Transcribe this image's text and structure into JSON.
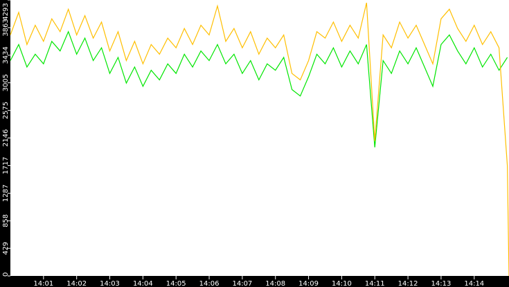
{
  "chart_data": {
    "type": "line",
    "title": "",
    "xlabel": "",
    "ylabel": "",
    "xlim_minutes": [
      0,
      15.05
    ],
    "ylim": [
      0,
      4293
    ],
    "grid": false,
    "background": "#ffffff",
    "axis_background": "#000000",
    "y_ticks": [
      "0",
      "429",
      "858",
      "1287",
      "1717",
      "2146",
      "2575",
      "3005",
      "3434",
      "3863",
      "4293"
    ],
    "y_tick_values": [
      0,
      429,
      858,
      1287,
      1717,
      2146,
      2575,
      3005,
      3434,
      3863,
      4293
    ],
    "x_ticks": [
      "14:01",
      "14:02",
      "14:03",
      "14:04",
      "14:05",
      "14:06",
      "14:07",
      "14:08",
      "14:09",
      "14:10",
      "14:11",
      "14:12",
      "14:13",
      "14:14"
    ],
    "x_tick_values": [
      1,
      2,
      3,
      4,
      5,
      6,
      7,
      8,
      9,
      10,
      11,
      12,
      13,
      14
    ],
    "series": [
      {
        "name": "green",
        "color": "#00e600",
        "x": [
          0,
          0.25,
          0.5,
          0.75,
          1,
          1.25,
          1.5,
          1.75,
          2,
          2.25,
          2.5,
          2.75,
          3,
          3.25,
          3.5,
          3.75,
          4,
          4.25,
          4.5,
          4.75,
          5,
          5.25,
          5.5,
          5.75,
          6,
          6.25,
          6.5,
          6.75,
          7,
          7.25,
          7.5,
          7.75,
          8,
          8.25,
          8.5,
          8.75,
          9,
          9.25,
          9.5,
          9.75,
          10,
          10.25,
          10.5,
          10.75,
          11,
          11.25,
          11.5,
          11.75,
          12,
          12.25,
          12.5,
          12.75,
          13,
          13.25,
          13.5,
          13.75,
          14,
          14.25,
          14.5,
          14.75,
          15
        ],
        "values": [
          3350,
          3600,
          3250,
          3450,
          3300,
          3650,
          3500,
          3800,
          3450,
          3700,
          3350,
          3550,
          3150,
          3400,
          3000,
          3250,
          2950,
          3200,
          3050,
          3300,
          3150,
          3450,
          3250,
          3500,
          3350,
          3600,
          3300,
          3450,
          3150,
          3350,
          3050,
          3300,
          3200,
          3400,
          2900,
          2800,
          3100,
          3450,
          3300,
          3550,
          3250,
          3500,
          3300,
          3600,
          2000,
          3350,
          3150,
          3500,
          3300,
          3550,
          3250,
          2950,
          3600,
          3750,
          3500,
          3300,
          3550,
          3250,
          3450,
          3200,
          3400
        ]
      },
      {
        "name": "yellow",
        "color": "#ffbf00",
        "x": [
          0,
          0.25,
          0.5,
          0.75,
          1,
          1.25,
          1.5,
          1.75,
          2,
          2.25,
          2.5,
          2.75,
          3,
          3.25,
          3.5,
          3.75,
          4,
          4.25,
          4.5,
          4.75,
          5,
          5.25,
          5.5,
          5.75,
          6,
          6.25,
          6.5,
          6.75,
          7,
          7.25,
          7.5,
          7.75,
          8,
          8.25,
          8.5,
          8.75,
          9,
          9.25,
          9.5,
          9.75,
          10,
          10.25,
          10.5,
          10.75,
          11,
          11.25,
          11.5,
          11.75,
          12,
          12.25,
          12.5,
          12.75,
          13,
          13.25,
          13.5,
          13.75,
          14,
          14.25,
          14.5,
          14.75,
          15,
          15.05
        ],
        "values": [
          3750,
          4100,
          3600,
          3900,
          3650,
          4000,
          3800,
          4150,
          3750,
          4050,
          3700,
          3950,
          3500,
          3800,
          3350,
          3650,
          3300,
          3600,
          3450,
          3700,
          3550,
          3850,
          3600,
          3900,
          3750,
          4200,
          3650,
          3850,
          3550,
          3800,
          3450,
          3700,
          3550,
          3750,
          3150,
          3050,
          3350,
          3800,
          3700,
          3950,
          3650,
          3900,
          3700,
          4250,
          2100,
          3750,
          3550,
          3950,
          3700,
          3900,
          3600,
          3300,
          4000,
          4150,
          3850,
          3650,
          3900,
          3600,
          3800,
          3550,
          1717,
          0
        ]
      }
    ]
  }
}
